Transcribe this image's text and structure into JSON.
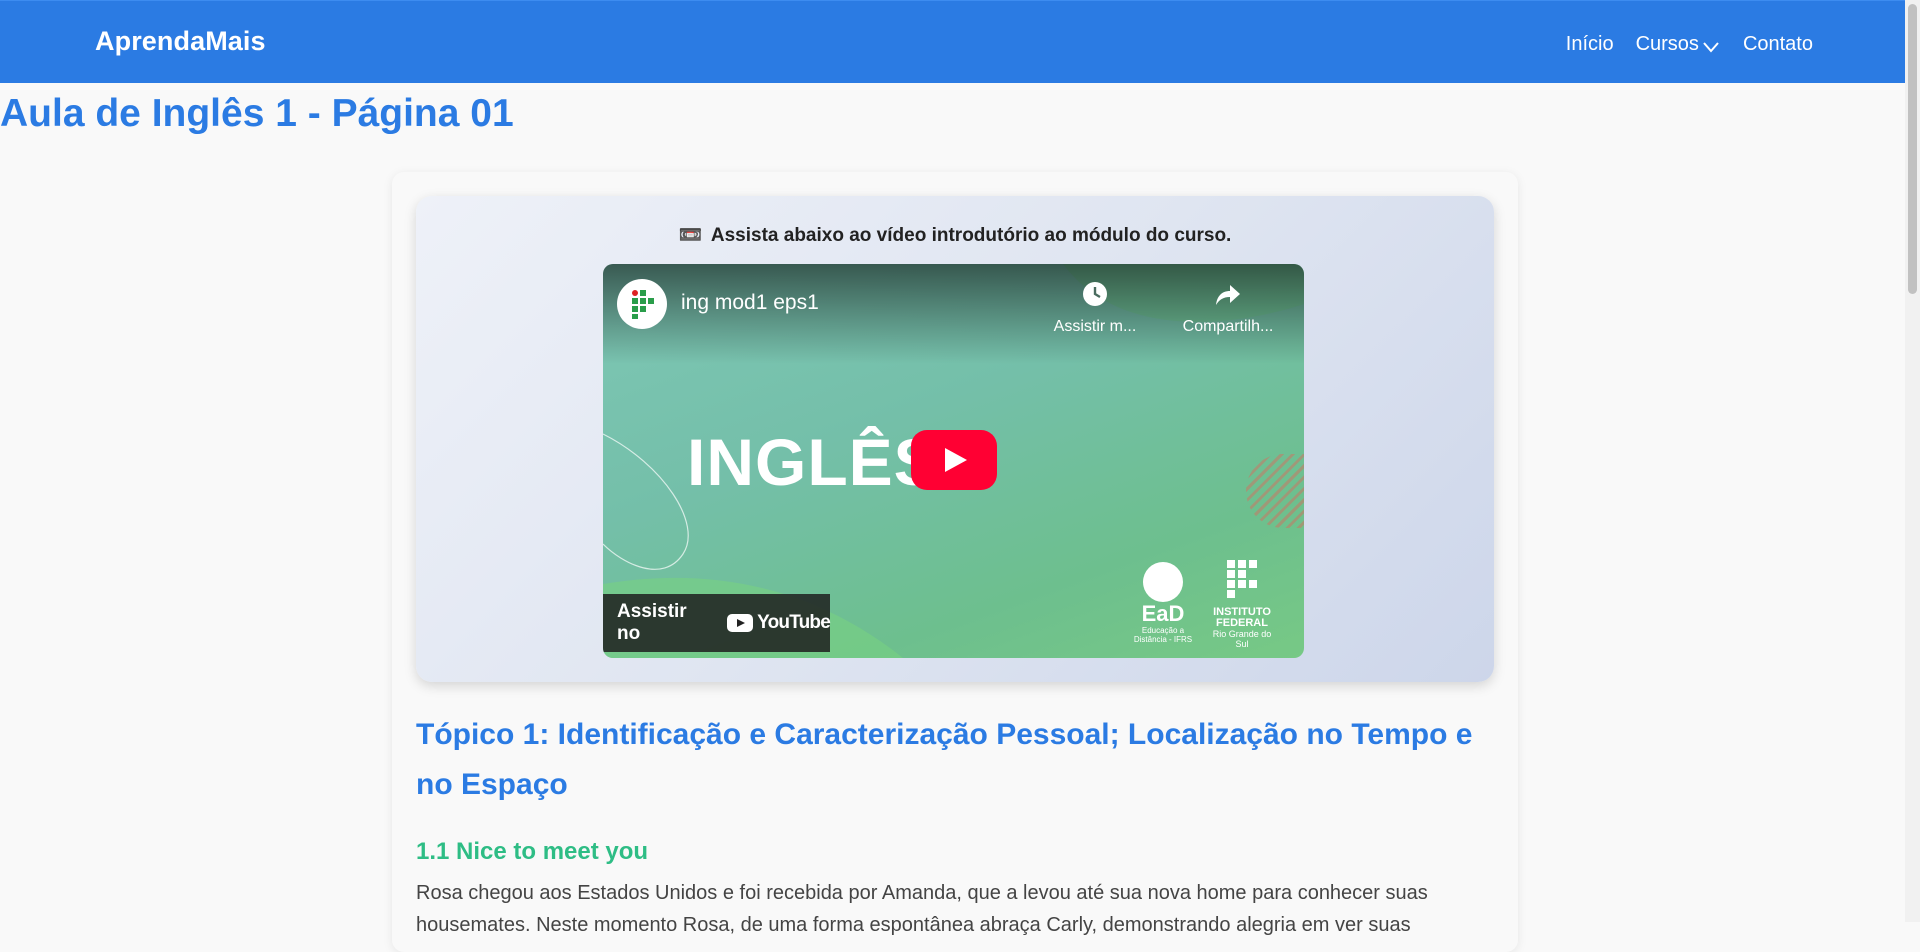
{
  "header": {
    "brand": "AprendaMais",
    "nav": {
      "home": "Início",
      "courses": "Cursos",
      "contact": "Contato"
    }
  },
  "page": {
    "title": "Aula de Inglês 1 - Página 01"
  },
  "video_section": {
    "caption_emoji": "📼",
    "caption": "Assista abaixo ao vídeo introdutório ao módulo do curso.",
    "player": {
      "video_title": "ing mod1 eps1",
      "watch_later": "Assistir m...",
      "share": "Compartilh...",
      "thumbnail_word": "INGLÊS",
      "watch_on": "Assistir no",
      "youtube": "YouTube",
      "ead_label": "EaD",
      "ead_sub": "Educação a Distância - IFRS",
      "if_label": "INSTITUTO FEDERAL",
      "if_sub": "Rio Grande do Sul"
    }
  },
  "topic": {
    "title": "Tópico 1: Identificação e Caracterização Pessoal; Localização no Tempo e no Espaço",
    "subtitle": "1.1 Nice to meet you",
    "paragraph": "Rosa chegou aos Estados Unidos e foi recebida por Amanda, que a levou até sua nova home para conhecer suas housemates. Neste momento Rosa, de uma forma espontânea abraça Carly, demonstrando alegria em ver suas"
  },
  "colors": {
    "primary": "#2b7be3",
    "accent_green": "#2ebd85",
    "youtube_red": "#ff0033"
  }
}
